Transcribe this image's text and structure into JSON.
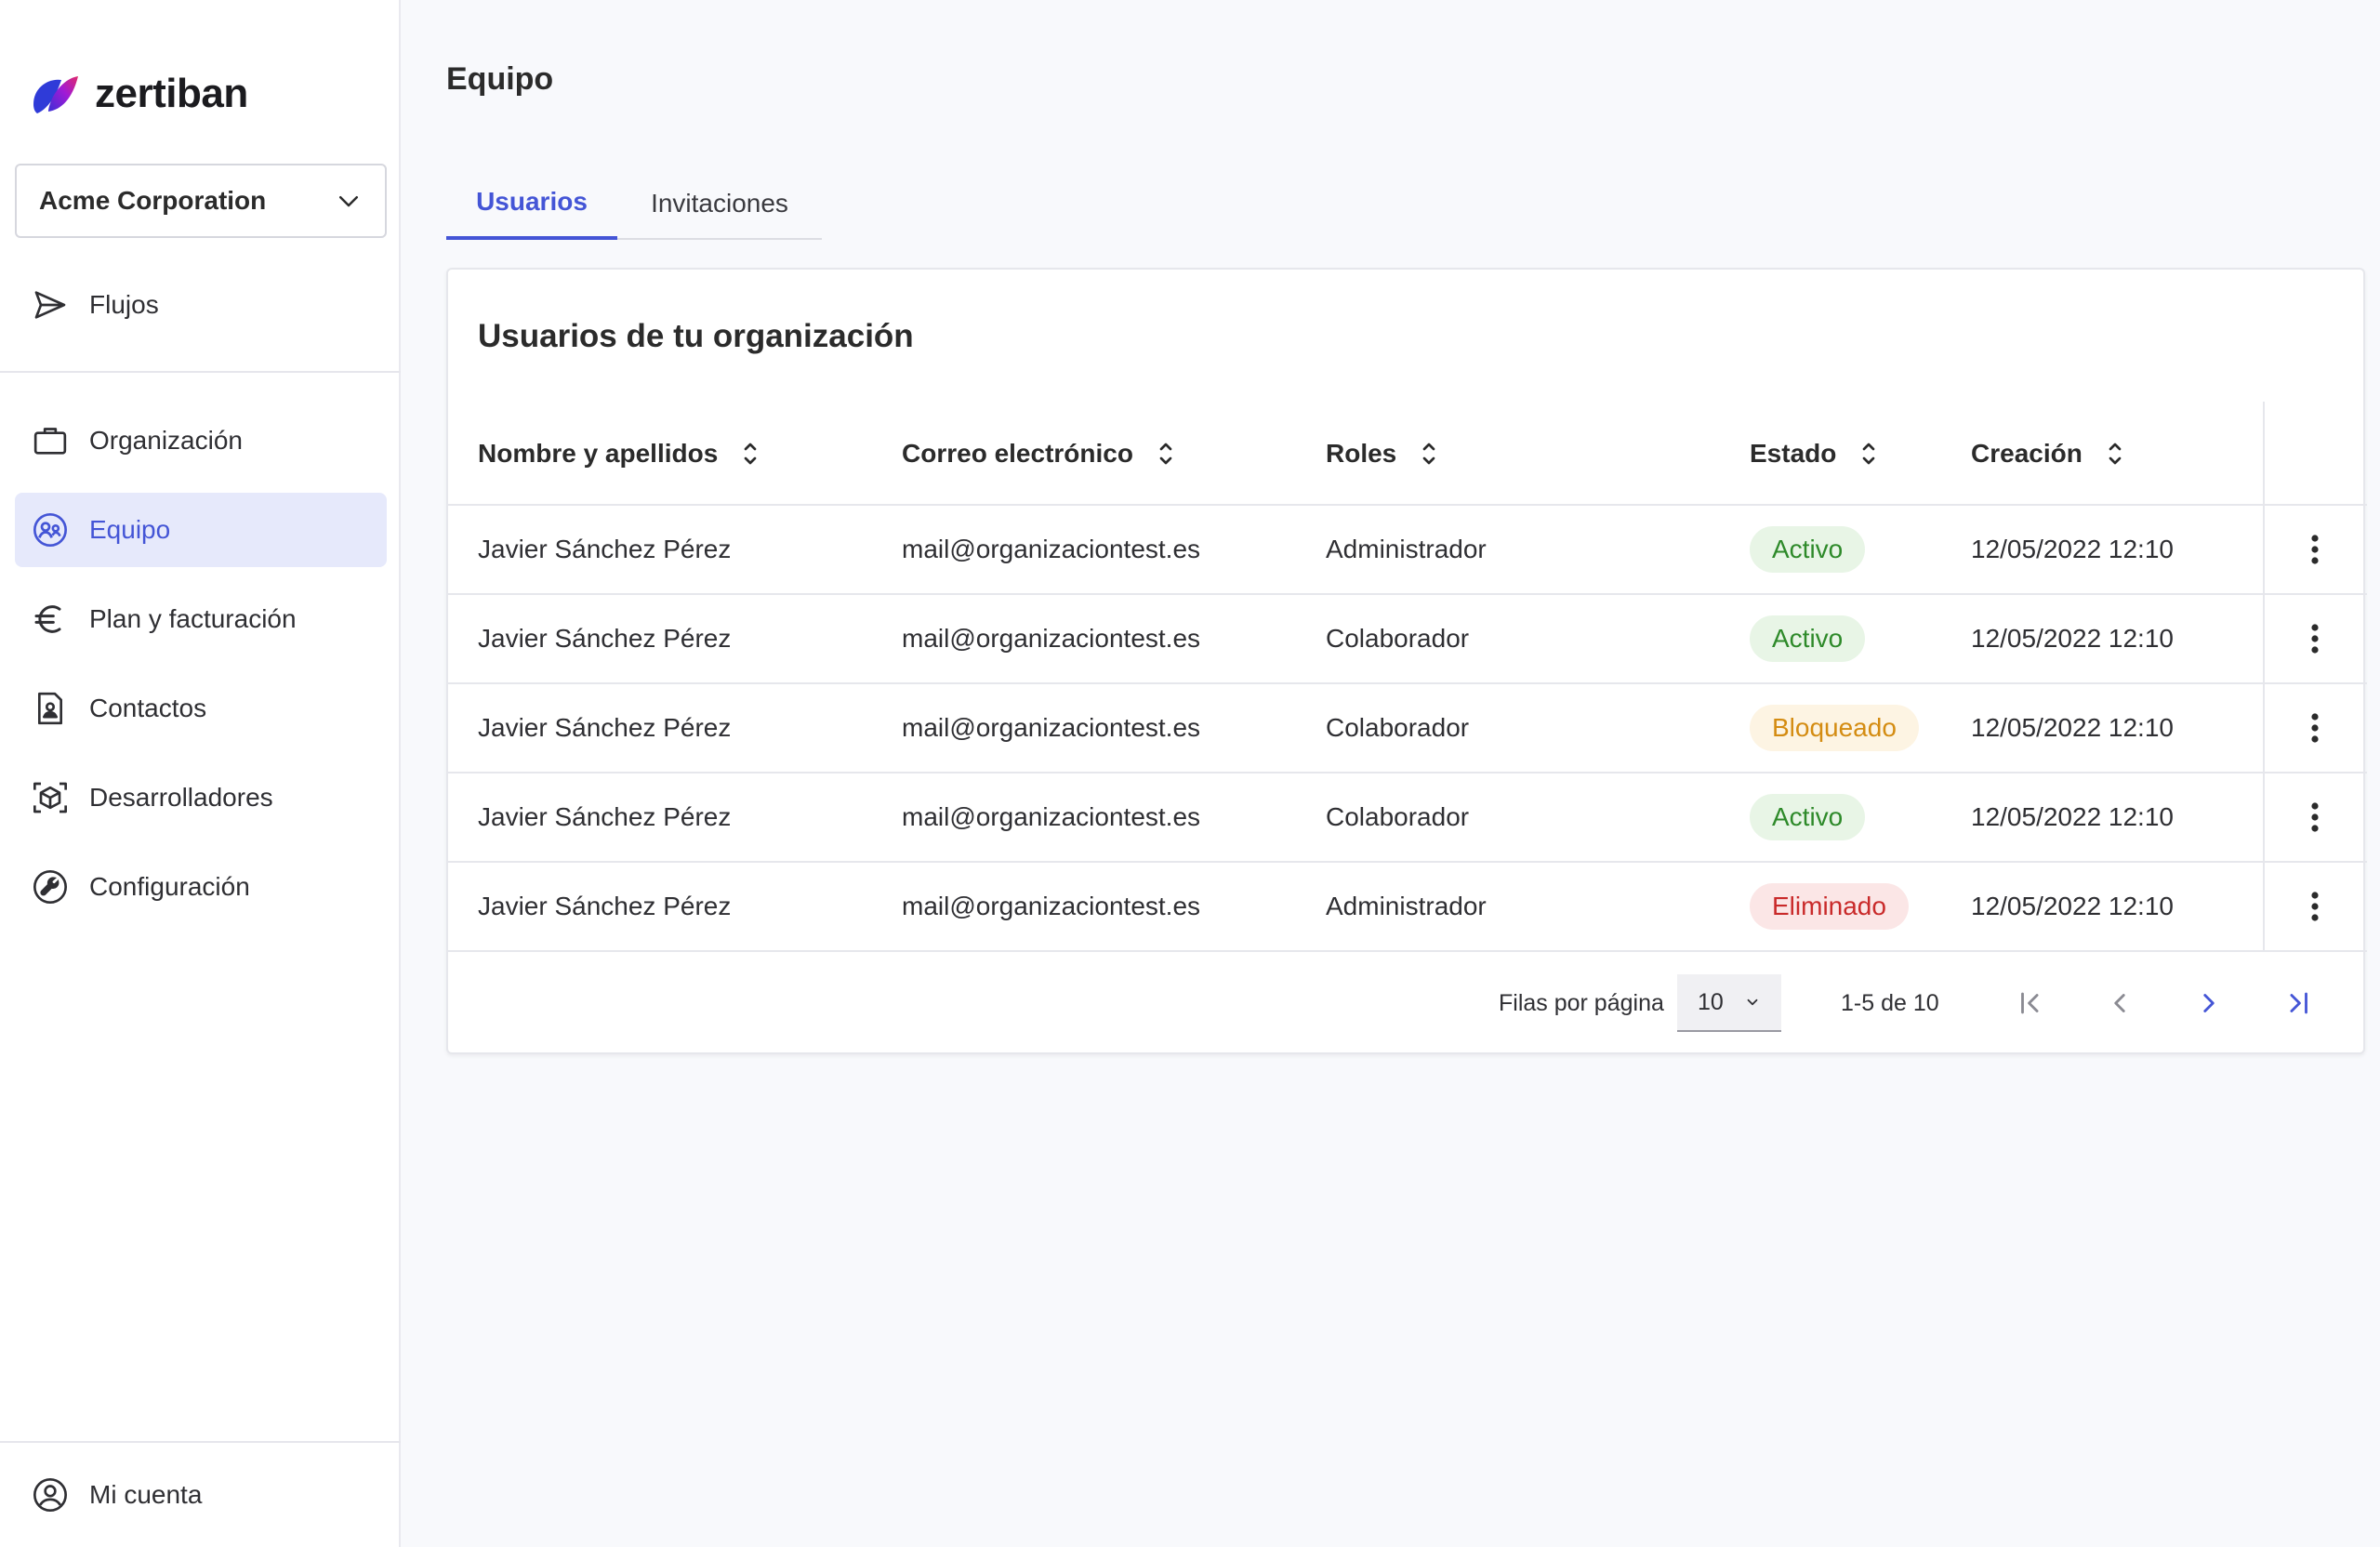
{
  "brand": {
    "name": "zertiban"
  },
  "org_selector": {
    "value": "Acme Corporation"
  },
  "sidebar": {
    "top_items": [
      {
        "label": "Flujos",
        "icon": "send-icon"
      }
    ],
    "items": [
      {
        "label": "Organización",
        "icon": "briefcase-icon"
      },
      {
        "label": "Equipo",
        "icon": "team-icon",
        "active": true
      },
      {
        "label": "Plan y facturación",
        "icon": "euro-icon"
      },
      {
        "label": "Contactos",
        "icon": "contact-icon"
      },
      {
        "label": "Desarrolladores",
        "icon": "cube-icon"
      },
      {
        "label": "Configuración",
        "icon": "wrench-icon"
      }
    ],
    "bottom_item": {
      "label": "Mi cuenta",
      "icon": "user-circle-icon"
    }
  },
  "page": {
    "title": "Equipo"
  },
  "tabs": [
    {
      "label": "Usuarios",
      "active": true
    },
    {
      "label": "Invitaciones",
      "active": false
    }
  ],
  "card": {
    "title": "Usuarios de tu organización"
  },
  "table": {
    "columns": [
      "Nombre y apellidos",
      "Correo electrónico",
      "Roles",
      "Estado",
      "Creación"
    ],
    "rows": [
      {
        "name": "Javier Sánchez Pérez",
        "email": "mail@organizaciontest.es",
        "role": "Administrador",
        "status": "Activo",
        "created": "12/05/2022 12:10"
      },
      {
        "name": "Javier Sánchez Pérez",
        "email": "mail@organizaciontest.es",
        "role": "Colaborador",
        "status": "Activo",
        "created": "12/05/2022 12:10"
      },
      {
        "name": "Javier Sánchez Pérez",
        "email": "mail@organizaciontest.es",
        "role": "Colaborador",
        "status": "Bloqueado",
        "created": "12/05/2022 12:10"
      },
      {
        "name": "Javier Sánchez Pérez",
        "email": "mail@organizaciontest.es",
        "role": "Colaborador",
        "status": "Activo",
        "created": "12/05/2022 12:10"
      },
      {
        "name": "Javier Sánchez Pérez",
        "email": "mail@organizaciontest.es",
        "role": "Administrador",
        "status": "Eliminado",
        "created": "12/05/2022 12:10"
      }
    ]
  },
  "status_colors": {
    "Activo": {
      "bg": "#e8f5e6",
      "fg": "#2e8a2a"
    },
    "Bloqueado": {
      "bg": "#fdf4e3",
      "fg": "#d48c12"
    },
    "Eliminado": {
      "bg": "#fbe6e6",
      "fg": "#c92a2a"
    }
  },
  "pagination": {
    "rows_label": "Filas por página",
    "rows_per_page": "10",
    "range": "1-5 de 10"
  },
  "colors": {
    "accent": "#4455d6",
    "active_bg": "#e6e9fb"
  }
}
